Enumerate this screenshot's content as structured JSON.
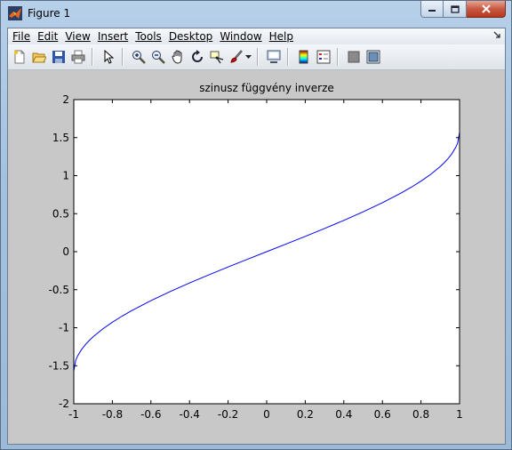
{
  "window": {
    "title": "Figure 1",
    "app_icon": "matlab-icon"
  },
  "menu": {
    "items": [
      "File",
      "Edit",
      "View",
      "Insert",
      "Tools",
      "Desktop",
      "Window",
      "Help"
    ],
    "dock_icon": "dock-arrow-icon"
  },
  "toolbar": {
    "icons": [
      "new-figure-icon",
      "open-file-icon",
      "save-icon",
      "print-icon",
      "edit-plot-arrow-icon",
      "zoom-in-icon",
      "zoom-out-icon",
      "pan-hand-icon",
      "rotate-3d-icon",
      "data-cursor-icon",
      "brush-icon",
      "brush-dropdown-icon",
      "link-plot-icon",
      "colorbar-icon",
      "legend-icon",
      "hide-plot-tools-icon",
      "show-plot-tools-icon"
    ]
  },
  "chart_data": {
    "type": "line",
    "title": "szinusz függvény inverze",
    "xlabel": "",
    "ylabel": "",
    "xlim": [
      -1,
      1
    ],
    "ylim": [
      -2,
      2
    ],
    "xticks": [
      -1,
      -0.8,
      -0.6,
      -0.4,
      -0.2,
      0,
      0.2,
      0.4,
      0.6,
      0.8,
      1
    ],
    "yticks": [
      -2,
      -1.5,
      -1,
      -0.5,
      0,
      0.5,
      1,
      1.5,
      2
    ],
    "xtick_labels": [
      "-1",
      "-0.8",
      "-0.6",
      "-0.4",
      "-0.2",
      "0",
      "0.2",
      "0.4",
      "0.6",
      "0.8",
      "1"
    ],
    "ytick_labels": [
      "-2",
      "-1.5",
      "-1",
      "-0.5",
      "0",
      "0.5",
      "1",
      "1.5",
      "2"
    ],
    "grid": false,
    "series": [
      {
        "color": "#0000ff",
        "x": [
          -1,
          -0.99,
          -0.98,
          -0.96,
          -0.94,
          -0.92,
          -0.9,
          -0.85,
          -0.8,
          -0.75,
          -0.7,
          -0.6,
          -0.5,
          -0.4,
          -0.3,
          -0.2,
          -0.1,
          0,
          0.1,
          0.2,
          0.3,
          0.4,
          0.5,
          0.6,
          0.7,
          0.75,
          0.8,
          0.85,
          0.9,
          0.92,
          0.94,
          0.96,
          0.98,
          0.99,
          1
        ],
        "y": [
          -1.5708,
          -1.4293,
          -1.3705,
          -1.287,
          -1.2226,
          -1.1681,
          -1.1198,
          -1.016,
          -0.9273,
          -0.8481,
          -0.7754,
          -0.6435,
          -0.5236,
          -0.4115,
          -0.3047,
          -0.2014,
          -0.1002,
          0,
          0.1002,
          0.2014,
          0.3047,
          0.4115,
          0.5236,
          0.6435,
          0.7754,
          0.8481,
          0.9273,
          1.016,
          1.1198,
          1.1681,
          1.2226,
          1.287,
          1.3705,
          1.4293,
          1.5708
        ]
      }
    ],
    "colors": {
      "axes_bg": "#ffffff",
      "figure_bg": "#c8c8c8",
      "axis": "#000000"
    }
  }
}
